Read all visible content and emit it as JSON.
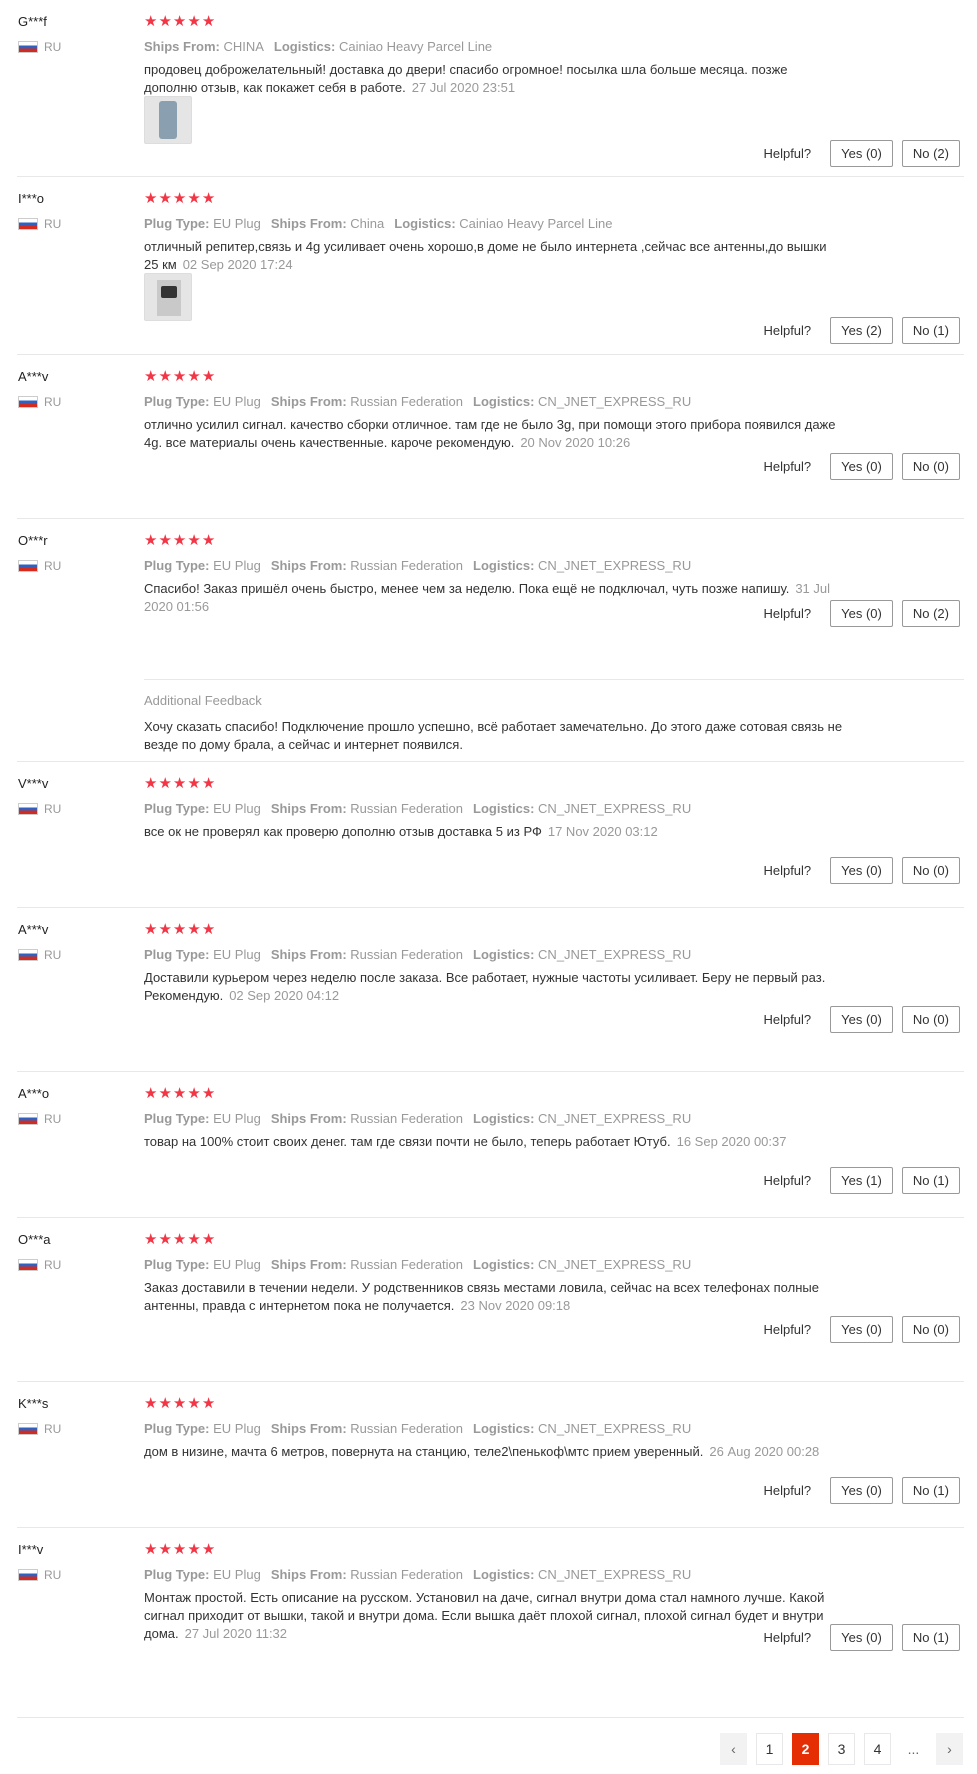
{
  "helpful_label": "Helpful?",
  "flag_icon": "russia-flag-icon",
  "star_icon": "star-icon",
  "accent_color": "#f23645",
  "reviews": [
    {
      "user": "G***f",
      "country": "RU",
      "rating": 5,
      "attributes": [
        {
          "label": "Ships From:",
          "value": "CHINA"
        },
        {
          "label": "Logistics:",
          "value": "Cainiao Heavy Parcel Line"
        }
      ],
      "text": "продовец доброжелательный! доставка до двери! спасибо огромное! посылка шла больше месяца. позже дополню отзыв, как покажет себя в работе.",
      "date": "27 Jul 2020 23:51",
      "has_photo": true,
      "yes": "Yes (0)",
      "no": "No (2)"
    },
    {
      "user": "I***o",
      "country": "RU",
      "rating": 5,
      "attributes": [
        {
          "label": "Plug Type:",
          "value": "EU Plug"
        },
        {
          "label": "Ships From:",
          "value": "China"
        },
        {
          "label": "Logistics:",
          "value": "Cainiao Heavy Parcel Line"
        }
      ],
      "text": "отличный репитер,связь и 4g усиливает очень хорошо,в доме не было интернета ,сейчас все антенны,до вышки 25 км",
      "date": "02 Sep 2020 17:24",
      "has_photo": true,
      "yes": "Yes (2)",
      "no": "No (1)"
    },
    {
      "user": "A***v",
      "country": "RU",
      "rating": 5,
      "attributes": [
        {
          "label": "Plug Type:",
          "value": "EU Plug"
        },
        {
          "label": "Ships From:",
          "value": "Russian Federation"
        },
        {
          "label": "Logistics:",
          "value": "CN_JNET_EXPRESS_RU"
        }
      ],
      "text": "отлично усилил сигнал. качество сборки отличное. там где не было 3g, при помощи этого прибора появился даже 4g. все материалы очень качественные. кароче рекомендую.",
      "date": "20 Nov 2020 10:26",
      "has_photo": false,
      "yes": "Yes (0)",
      "no": "No (0)"
    },
    {
      "user": "O***r",
      "country": "RU",
      "rating": 5,
      "attributes": [
        {
          "label": "Plug Type:",
          "value": "EU Plug"
        },
        {
          "label": "Ships From:",
          "value": "Russian Federation"
        },
        {
          "label": "Logistics:",
          "value": "CN_JNET_EXPRESS_RU"
        }
      ],
      "text": "Спасибо! Заказ пришёл очень быстро, менее чем за неделю. Пока ещё не подключал, чуть позже напишу.",
      "date": "31 Jul 2020 01:56",
      "has_photo": false,
      "yes": "Yes (0)",
      "no": "No (2)",
      "additional_title": "Additional Feedback",
      "additional_text": "Хочу сказать спасибо! Подключение прошло успешно, всё работает замечательно. До этого даже сотовая связь не везде по дому брала, а сейчас и интернет появился."
    },
    {
      "user": "V***v",
      "country": "RU",
      "rating": 5,
      "attributes": [
        {
          "label": "Plug Type:",
          "value": "EU Plug"
        },
        {
          "label": "Ships From:",
          "value": "Russian Federation"
        },
        {
          "label": "Logistics:",
          "value": "CN_JNET_EXPRESS_RU"
        }
      ],
      "text": "все ок не проверял как проверю дополню отзыв доставка 5 из РФ",
      "date": "17 Nov 2020 03:12",
      "has_photo": false,
      "yes": "Yes (0)",
      "no": "No (0)"
    },
    {
      "user": "A***v",
      "country": "RU",
      "rating": 5,
      "attributes": [
        {
          "label": "Plug Type:",
          "value": "EU Plug"
        },
        {
          "label": "Ships From:",
          "value": "Russian Federation"
        },
        {
          "label": "Logistics:",
          "value": "CN_JNET_EXPRESS_RU"
        }
      ],
      "text": "Доставили курьером через неделю после заказа. Все работает, нужные частоты усиливает. Беру не первый раз. Рекомендую.",
      "date": "02 Sep 2020 04:12",
      "has_photo": false,
      "yes": "Yes (0)",
      "no": "No (0)"
    },
    {
      "user": "A***o",
      "country": "RU",
      "rating": 5,
      "attributes": [
        {
          "label": "Plug Type:",
          "value": "EU Plug"
        },
        {
          "label": "Ships From:",
          "value": "Russian Federation"
        },
        {
          "label": "Logistics:",
          "value": "CN_JNET_EXPRESS_RU"
        }
      ],
      "text": "товар на 100% стоит своих денег. там где связи почти не было, теперь работает Ютуб.",
      "date": "16 Sep 2020 00:37",
      "has_photo": false,
      "yes": "Yes (1)",
      "no": "No (1)"
    },
    {
      "user": "O***a",
      "country": "RU",
      "rating": 5,
      "attributes": [
        {
          "label": "Plug Type:",
          "value": "EU Plug"
        },
        {
          "label": "Ships From:",
          "value": "Russian Federation"
        },
        {
          "label": "Logistics:",
          "value": "CN_JNET_EXPRESS_RU"
        }
      ],
      "text": "Заказ доставили в течении недели. У родственников связь местами ловила, сейчас на всех телефонах полные антенны, правда с интернетом пока не получается.",
      "date": "23 Nov 2020 09:18",
      "has_photo": false,
      "yes": "Yes (0)",
      "no": "No (0)"
    },
    {
      "user": "K***s",
      "country": "RU",
      "rating": 5,
      "attributes": [
        {
          "label": "Plug Type:",
          "value": "EU Plug"
        },
        {
          "label": "Ships From:",
          "value": "Russian Federation"
        },
        {
          "label": "Logistics:",
          "value": "CN_JNET_EXPRESS_RU"
        }
      ],
      "text": "дом в низине, мачта 6 метров, повернута на станцию, теле2\\пенькоф\\мтс прием уверенный.",
      "date": "26 Aug 2020 00:28",
      "has_photo": false,
      "yes": "Yes (0)",
      "no": "No (1)"
    },
    {
      "user": "I***v",
      "country": "RU",
      "rating": 5,
      "attributes": [
        {
          "label": "Plug Type:",
          "value": "EU Plug"
        },
        {
          "label": "Ships From:",
          "value": "Russian Federation"
        },
        {
          "label": "Logistics:",
          "value": "CN_JNET_EXPRESS_RU"
        }
      ],
      "text": "Монтаж простой. Есть описание на русском. Установил на даче, сигнал внутри дома стал намного лучше. Какой сигнал приходит от вышки, такой и внутри дома. Если вышка даёт плохой сигнал, плохой сигнал будет и внутри дома.",
      "date": "27 Jul 2020 11:32",
      "has_photo": false,
      "yes": "Yes (0)",
      "no": "No (1)"
    }
  ],
  "pagination": {
    "prev_icon": "chevron-left-icon",
    "next_icon": "chevron-right-icon",
    "prev_glyph": "‹",
    "next_glyph": "›",
    "pages": [
      "1",
      "2",
      "3",
      "4"
    ],
    "current": "2",
    "ellipsis": "..."
  }
}
